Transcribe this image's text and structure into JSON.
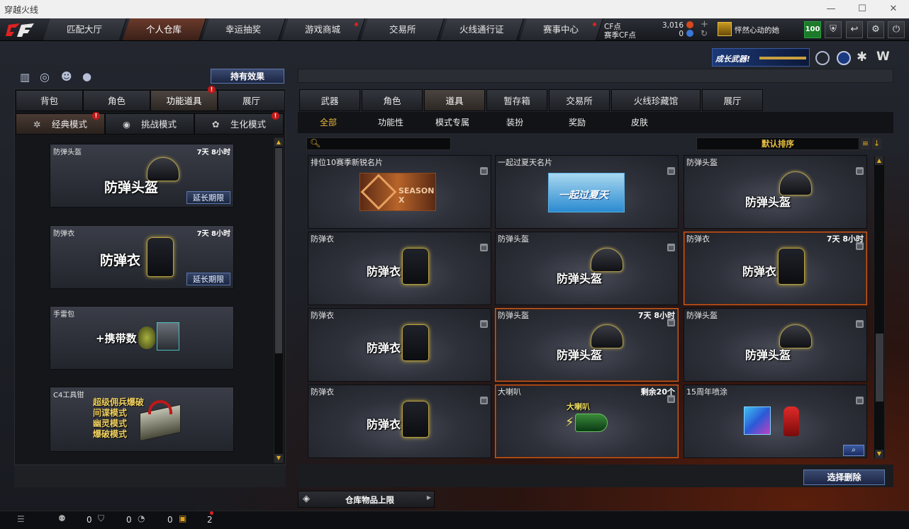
{
  "window": {
    "title": "穿越火线"
  },
  "nav": {
    "items": [
      {
        "label": "匹配大厅",
        "active": false,
        "dot": false
      },
      {
        "label": "个人仓库",
        "active": true,
        "dot": false
      },
      {
        "label": "幸运抽奖",
        "active": false,
        "dot": false
      },
      {
        "label": "游戏商城",
        "active": false,
        "dot": true
      },
      {
        "label": "交易所",
        "active": false,
        "dot": false
      },
      {
        "label": "火线通行证",
        "active": false,
        "dot": false
      },
      {
        "label": "赛事中心",
        "active": false,
        "dot": true
      }
    ]
  },
  "currency": {
    "cf_label": "CF点",
    "cf_value": "3,016",
    "season_label": "赛季CF点",
    "season_value": "0"
  },
  "user": {
    "name": "怦然心动的她",
    "level": "100"
  },
  "banner": {
    "text": "成长武器!"
  },
  "left": {
    "effects_button": "持有效果",
    "tabs": [
      {
        "label": "背包",
        "active": false
      },
      {
        "label": "角色",
        "active": false
      },
      {
        "label": "功能道具",
        "active": true
      },
      {
        "label": "展厅",
        "active": false
      }
    ],
    "modes": [
      {
        "label": "经典模式",
        "active": true
      },
      {
        "label": "挑战模式",
        "active": false
      },
      {
        "label": "生化模式",
        "active": false
      }
    ],
    "cards": [
      {
        "name": "防弹头盔",
        "time": "7天 8小时",
        "big": "防弹头盔",
        "button": "延长期限"
      },
      {
        "name": "防弹衣",
        "time": "7天 8小时",
        "big": "防弹衣",
        "button": "延长期限"
      },
      {
        "name": "手雷包",
        "big": "+携带数"
      },
      {
        "name": "C4工具钳",
        "lines": [
          "超级佣兵爆破",
          "间谍模式",
          "幽灵模式",
          "爆破模式"
        ]
      }
    ]
  },
  "right": {
    "tabs": [
      {
        "label": "武器",
        "active": false
      },
      {
        "label": "角色",
        "active": false
      },
      {
        "label": "道具",
        "active": true
      },
      {
        "label": "暂存箱",
        "active": false
      },
      {
        "label": "交易所",
        "active": false
      },
      {
        "label": "火线珍藏馆",
        "active": false
      },
      {
        "label": "展厅",
        "active": false
      }
    ],
    "subtabs": [
      {
        "label": "全部",
        "active": true
      },
      {
        "label": "功能性",
        "active": false
      },
      {
        "label": "模式专属",
        "active": false
      },
      {
        "label": "装扮",
        "active": false
      },
      {
        "label": "奖励",
        "active": false
      },
      {
        "label": "皮肤",
        "active": false
      }
    ],
    "search_placeholder": "",
    "sort_label": "默认排序",
    "items": [
      {
        "name": "排位10赛季新锐名片",
        "kind": "season",
        "img_text": "SEASON X"
      },
      {
        "name": "一起过夏天名片",
        "kind": "summer",
        "img_text": "一起过夏天"
      },
      {
        "name": "防弹头盔",
        "kind": "helmet",
        "big": "防弹头盔"
      },
      {
        "name": "防弹衣",
        "kind": "vest",
        "big": "防弹衣"
      },
      {
        "name": "防弹头盔",
        "kind": "helmet",
        "big": "防弹头盔"
      },
      {
        "name": "防弹衣",
        "kind": "vest",
        "big": "防弹衣",
        "time": "7天 8小时",
        "selected": true
      },
      {
        "name": "防弹衣",
        "kind": "vest",
        "big": "防弹衣"
      },
      {
        "name": "防弹头盔",
        "kind": "helmet",
        "big": "防弹头盔",
        "time": "7天 8小时",
        "selected": true
      },
      {
        "name": "防弹头盔",
        "kind": "helmet",
        "big": "防弹头盔"
      },
      {
        "name": "防弹衣",
        "kind": "vest",
        "big": "防弹衣"
      },
      {
        "name": "大喇叭",
        "kind": "horn",
        "big": "大喇叭",
        "time": "剩余20个",
        "selected": true
      },
      {
        "name": "15周年喷涂",
        "kind": "spray"
      }
    ],
    "delete_button": "选择删除",
    "capacity_label": "仓库物品上限"
  },
  "bottom": {
    "counts": [
      "0",
      "0",
      "0",
      "2"
    ]
  }
}
